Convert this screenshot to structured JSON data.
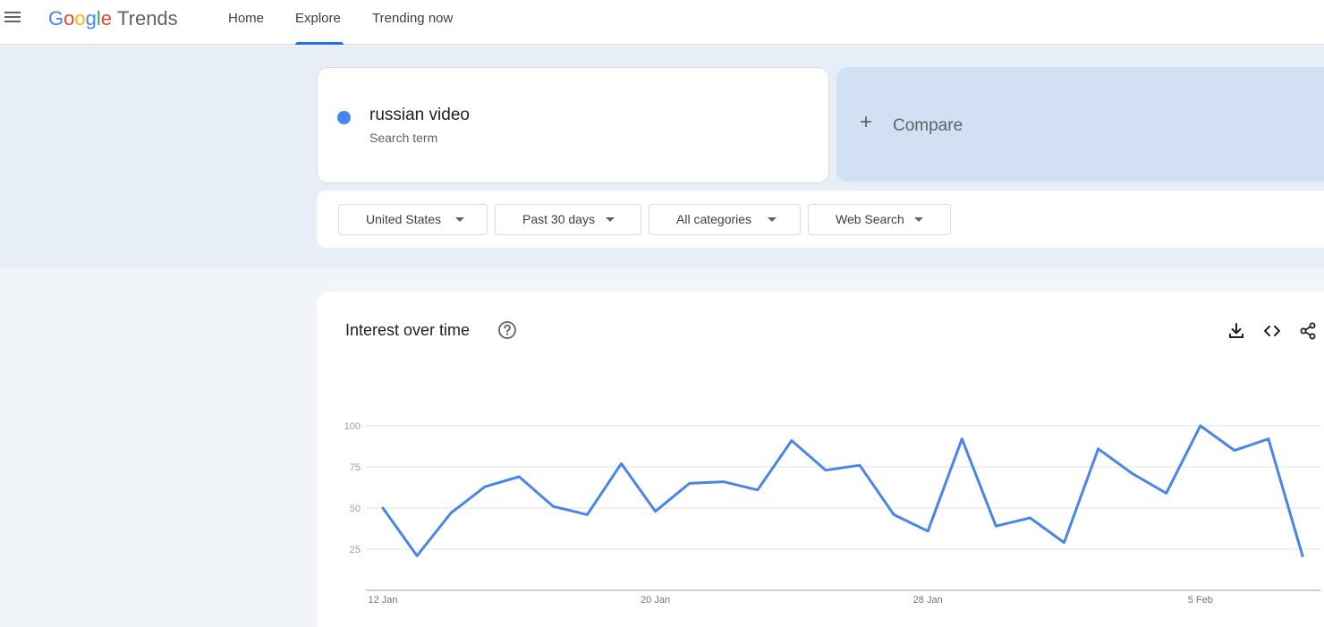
{
  "header": {
    "logo_google": [
      "G",
      "o",
      "o",
      "g",
      "l",
      "e"
    ],
    "logo_product": "Trends",
    "nav": [
      {
        "label": "Home"
      },
      {
        "label": "Explore",
        "active": true
      },
      {
        "label": "Trending now"
      }
    ]
  },
  "search": {
    "term": "russian video",
    "term_type": "Search term",
    "term_color": "#4285f4",
    "compare_label": "Compare"
  },
  "filters": [
    {
      "label": "United States"
    },
    {
      "label": "Past 30 days"
    },
    {
      "label": "All categories"
    },
    {
      "label": "Web Search"
    }
  ],
  "card": {
    "title": "Interest over time",
    "icons": [
      "help-icon",
      "download-icon",
      "embed-icon",
      "share-icon"
    ]
  },
  "chart_data": {
    "type": "line",
    "title": "",
    "xlabel": "",
    "ylabel": "",
    "ylim": [
      0,
      100
    ],
    "y_ticks": [
      25,
      50,
      75,
      100
    ],
    "grid": true,
    "x_tick_labels": [
      {
        "label": "12 Jan",
        "index": 0
      },
      {
        "label": "20 Jan",
        "index": 8
      },
      {
        "label": "28 Jan",
        "index": 16
      },
      {
        "label": "5 Feb",
        "index": 24
      }
    ],
    "series": [
      {
        "color": "#4a86e8",
        "x": [
          "12 Jan",
          "13 Jan",
          "14 Jan",
          "15 Jan",
          "16 Jan",
          "17 Jan",
          "18 Jan",
          "19 Jan",
          "20 Jan",
          "21 Jan",
          "22 Jan",
          "23 Jan",
          "24 Jan",
          "25 Jan",
          "26 Jan",
          "27 Jan",
          "28 Jan",
          "29 Jan",
          "30 Jan",
          "31 Jan",
          "1 Feb",
          "2 Feb",
          "3 Feb",
          "4 Feb",
          "5 Feb",
          "6 Feb",
          "7 Feb",
          "8 Feb"
        ],
        "values": [
          50,
          21,
          47,
          63,
          69,
          51,
          46,
          77,
          48,
          65,
          66,
          61,
          91,
          73,
          76,
          46,
          36,
          92,
          39,
          44,
          29,
          86,
          71,
          59,
          100,
          85,
          92,
          21
        ]
      }
    ]
  }
}
